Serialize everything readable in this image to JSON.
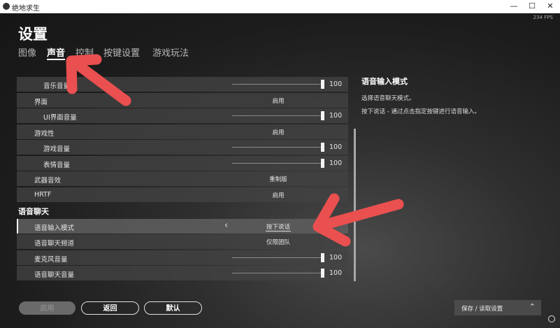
{
  "window": {
    "title": "绝地求生",
    "minimize": "—",
    "maximize": "☐",
    "close": "✕"
  },
  "fps": "234 FPS",
  "page_title": "设置",
  "tabs": [
    {
      "label": "图像",
      "active": false
    },
    {
      "label": "声音",
      "active": true
    },
    {
      "label": "控制",
      "active": false
    },
    {
      "label": "按键设置",
      "active": false
    },
    {
      "label": "游戏玩法",
      "active": false
    }
  ],
  "settings": {
    "music_volume": {
      "label": "音乐音量",
      "value": "100",
      "level": 1.0
    },
    "ui": {
      "label": "界面",
      "value": "启用"
    },
    "ui_volume": {
      "label": "UI界面音量",
      "value": "100",
      "level": 1.0
    },
    "gameplay": {
      "label": "游戏性",
      "value": "启用"
    },
    "game_volume": {
      "label": "游戏音量",
      "value": "100",
      "level": 1.0
    },
    "emote_volume": {
      "label": "表情音量",
      "value": "100",
      "level": 1.0
    },
    "weapon_sound": {
      "label": "武器音效",
      "value": "重制版"
    },
    "hrtf": {
      "label": "HRTF",
      "value": "启用"
    }
  },
  "voice_chat": {
    "section_label": "语音聊天",
    "input_mode": {
      "label": "语音输入模式",
      "value": "按下说话",
      "prev": "‹"
    },
    "channel": {
      "label": "语音聊天频道",
      "value": "仅限团队"
    },
    "mic_volume": {
      "label": "麦克风音量",
      "value": "100",
      "level": 1.0
    },
    "chat_volume": {
      "label": "语音聊天音量",
      "value": "100",
      "level": 1.0
    }
  },
  "description": {
    "title": "语音输入模式",
    "line1": "选择语音聊天模式。",
    "line2": "按下说话 - 通过点击指定按键进行语音输入。"
  },
  "buttons": {
    "apply": "应用",
    "back": "返回",
    "default": "默认"
  },
  "save_load": {
    "label": "保存 / 读取设置",
    "chevron": "⌃"
  },
  "colors": {
    "annotation_arrow": "#e9504f",
    "active_tab": "#ffffff"
  }
}
